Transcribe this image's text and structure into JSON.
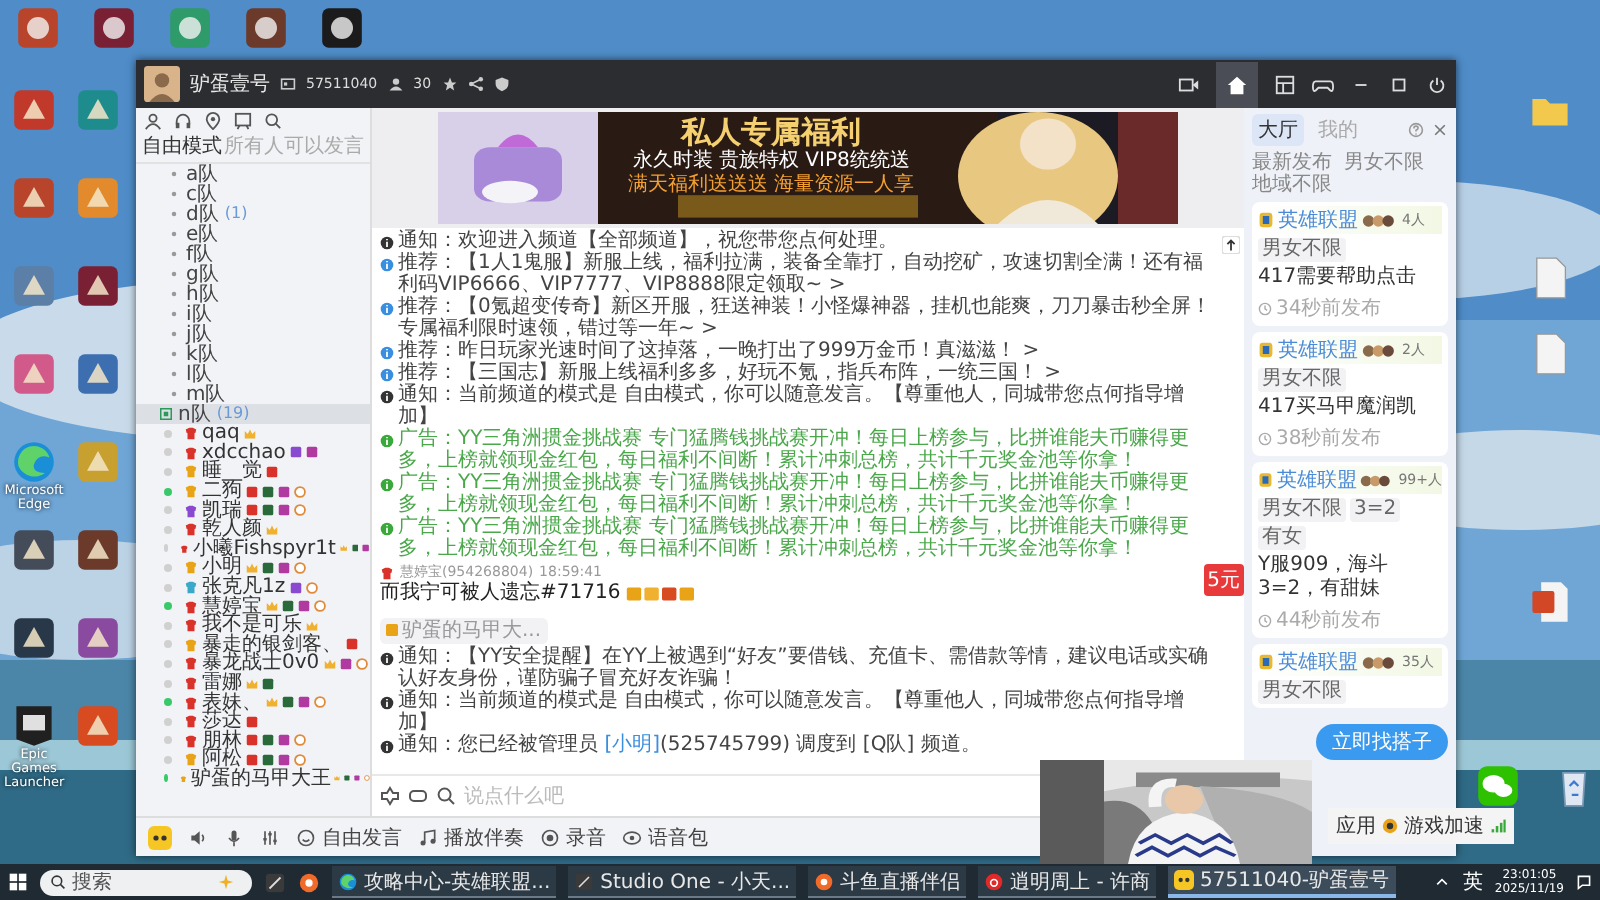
{
  "desktop": {
    "top_icons": [
      {
        "kind": "app"
      },
      {
        "kind": "app"
      },
      {
        "kind": "app"
      },
      {
        "kind": "app"
      },
      {
        "kind": "app"
      }
    ],
    "left_icons": [
      {
        "kind": "app"
      },
      {
        "kind": "app"
      },
      {
        "kind": "app"
      },
      {
        "kind": "app"
      },
      {
        "kind": "app"
      },
      {
        "kind": "app"
      },
      {
        "kind": "app"
      },
      {
        "kind": "app"
      },
      {
        "kind": "edge",
        "label": "Microsoft Edge"
      },
      {
        "kind": "app"
      },
      {
        "kind": "app"
      },
      {
        "kind": "app"
      },
      {
        "kind": "app"
      },
      {
        "kind": "app"
      },
      {
        "kind": "epic",
        "label": "Epic Games Launcher"
      },
      {
        "kind": "app"
      }
    ],
    "right_icons": [
      {
        "kind": "folder"
      },
      {
        "kind": "file"
      },
      {
        "kind": "file"
      },
      {
        "kind": "ppt"
      }
    ],
    "bottom_icons": [
      {
        "kind": "wechat"
      },
      {
        "kind": "recycle"
      }
    ]
  },
  "window": {
    "title": "驴蛋壹号",
    "channel_id": "57511040",
    "online": "30"
  },
  "left_panel": {
    "mode": "自由模式",
    "mode_hint": "所有人可以发言",
    "channels": [
      {
        "name": "a队",
        "expanded": false
      },
      {
        "name": "c队",
        "expanded": false
      },
      {
        "name": "d队",
        "count": "(1)",
        "expanded": false
      },
      {
        "name": "e队",
        "expanded": false
      },
      {
        "name": "f队",
        "expanded": false
      },
      {
        "name": "g队",
        "expanded": false
      },
      {
        "name": "h队",
        "expanded": false
      },
      {
        "name": "i队",
        "expanded": false
      },
      {
        "name": "j队",
        "expanded": false
      },
      {
        "name": "k队",
        "expanded": false
      },
      {
        "name": "l队",
        "expanded": false
      },
      {
        "name": "m队",
        "expanded": false
      },
      {
        "name": "n队",
        "count": "(19)",
        "expanded": true,
        "children": [
          {
            "name": "qaq",
            "online": false,
            "kind": "red",
            "badges": [
              {
                "kind": "crown"
              }
            ]
          },
          {
            "name": "xdcchao",
            "online": false,
            "kind": "red",
            "badges": [
              {
                "kind": "purple"
              },
              {
                "kind": "vip"
              }
            ]
          },
          {
            "name": "睡__觉",
            "online": false,
            "kind": "gold",
            "badges": [
              {
                "kind": "red"
              }
            ]
          },
          {
            "name": "二狗",
            "online": true,
            "kind": "gold",
            "badges": [
              {
                "kind": "red"
              },
              {
                "kind": "level"
              },
              {
                "kind": "vip"
              },
              {
                "kind": "medal"
              }
            ]
          },
          {
            "name": "凯瑞",
            "online": false,
            "kind": "purple",
            "badges": [
              {
                "kind": "red"
              },
              {
                "kind": "level"
              },
              {
                "kind": "vip"
              },
              {
                "kind": "medal"
              }
            ]
          },
          {
            "name": "乾人颜",
            "online": false,
            "kind": "red",
            "badges": [
              {
                "kind": "crown"
              }
            ]
          },
          {
            "name": "小曦Fishspyr1t",
            "online": false,
            "kind": "red",
            "badges": [
              {
                "kind": "crown"
              },
              {
                "kind": "level"
              },
              {
                "kind": "vip"
              }
            ]
          },
          {
            "name": "小明",
            "online": false,
            "kind": "gold",
            "badges": [
              {
                "kind": "crown"
              },
              {
                "kind": "level"
              },
              {
                "kind": "vip"
              },
              {
                "kind": "medal"
              }
            ]
          },
          {
            "name": "张克凡1z",
            "online": false,
            "kind": "blue",
            "badges": [
              {
                "kind": "purple"
              },
              {
                "kind": "medal"
              }
            ]
          },
          {
            "name": "慧婷宝",
            "online": true,
            "kind": "red",
            "badges": [
              {
                "kind": "crown"
              },
              {
                "kind": "level"
              },
              {
                "kind": "vip"
              },
              {
                "kind": "medal"
              }
            ]
          },
          {
            "name": "我不是可乐",
            "online": false,
            "kind": "red",
            "badges": [
              {
                "kind": "crown"
              }
            ]
          },
          {
            "name": "暴走的银剑客、",
            "online": false,
            "kind": "gold",
            "badges": [
              {
                "kind": "red"
              }
            ]
          },
          {
            "name": "暴龙战士0v0",
            "online": false,
            "kind": "red",
            "badges": [
              {
                "kind": "crown"
              },
              {
                "kind": "vip"
              },
              {
                "kind": "medal"
              }
            ]
          },
          {
            "name": "雷娜",
            "online": false,
            "kind": "red",
            "badges": [
              {
                "kind": "crown"
              },
              {
                "kind": "level"
              }
            ]
          },
          {
            "name": "表妹、",
            "online": true,
            "kind": "red",
            "badges": [
              {
                "kind": "crown"
              },
              {
                "kind": "level"
              },
              {
                "kind": "vip"
              },
              {
                "kind": "medal"
              }
            ]
          },
          {
            "name": "莎达",
            "online": false,
            "kind": "red",
            "badges": [
              {
                "kind": "red"
              }
            ]
          },
          {
            "name": "朋林",
            "online": false,
            "kind": "red",
            "badges": [
              {
                "kind": "red"
              },
              {
                "kind": "level"
              },
              {
                "kind": "vip"
              },
              {
                "kind": "medal"
              }
            ]
          },
          {
            "name": "阿松",
            "online": false,
            "kind": "gold",
            "badges": [
              {
                "kind": "red"
              },
              {
                "kind": "level"
              },
              {
                "kind": "vip"
              },
              {
                "kind": "medal"
              }
            ]
          },
          {
            "name": "驴蛋的马甲大王",
            "online": true,
            "kind": "gold",
            "badges": [
              {
                "kind": "crown"
              },
              {
                "kind": "level"
              },
              {
                "kind": "vip"
              },
              {
                "kind": "medal"
              }
            ]
          }
        ]
      }
    ]
  },
  "banner": {
    "title": "私人专属福利",
    "subtitle": "永久时装 贵族特权 VIP8统统送",
    "slogan": "满天福利送送送 海量资源一人享"
  },
  "messages": [
    {
      "kind": "notice",
      "label": "通知：",
      "text": "欢迎进入频道【全部频道】，祝您带您点何处理。"
    },
    {
      "kind": "recommend",
      "label": "推荐：",
      "text": "【1人1鬼服】新服上线，福利拉满，装备全靠打，自动挖矿，攻速切割全满！还有福利码VIP6666、VIP7777、VIP8888限定领取~ >"
    },
    {
      "kind": "recommend",
      "label": "推荐：",
      "text": "【0氪超变传奇】新区开服，狂送神装！小怪爆神器，挂机也能爽，刀刀暴击秒全屏！专属福利限时速领，错过等一年~ >"
    },
    {
      "kind": "recommend",
      "label": "推荐：",
      "text": "昨日玩家光速时间了这掉落，一晚打出了999万金币！真滋滋！ >"
    },
    {
      "kind": "recommend",
      "label": "推荐：",
      "text": "【三国志】新服上线福利多多，好玩不氪，指兵布阵，一统三国！ >"
    },
    {
      "kind": "notice",
      "label": "通知：",
      "text": "当前频道的模式是 自由模式，你可以随意发言。【尊重他人，同城带您点何指导增加】"
    },
    {
      "kind": "ad",
      "label": "广告：",
      "text": "YY三角洲掼金挑战赛 专门猛腾钱挑战赛开冲！每日上榜参与，比拼谁能夫币赚得更多，上榜就领现金红包，每日福利不间断！累计冲刺总榜，共计千元奖金池等你拿！"
    },
    {
      "kind": "ad",
      "label": "广告：",
      "text": "YY三角洲掼金挑战赛 专门猛腾钱挑战赛开冲！每日上榜参与，比拼谁能夫币赚得更多，上榜就领现金红包，每日福利不间断！累计冲刺总榜，共计千元奖金池等你拿！"
    },
    {
      "kind": "ad",
      "label": "广告：",
      "text": "YY三角洲掼金挑战赛 专门猛腾钱挑战赛开冲！每日上榜参与，比拼谁能夫币赚得更多，上榜就领现金红包，每日福利不间断！累计冲刺总榜，共计千元奖金池等你拿！"
    },
    {
      "kind": "chat",
      "user": "慧婷宝(954268804)",
      "time": "18:59:41",
      "text": "而我宁可被人遗忘#71716",
      "reply": "驴蛋的马甲大..."
    },
    {
      "kind": "notice",
      "label": "通知：",
      "text": "【YY安全提醒】在YY上被遇到“好友”要借钱、充值卡、需借款等情，建议电话或实确认好友身份，谨防骗子冒充好友诈骗！"
    },
    {
      "kind": "notice",
      "label": "通知：",
      "text": "当前频道的模式是 自由模式，你可以随意发言。【尊重他人，同城带您点何指导增加】"
    },
    {
      "kind": "notice",
      "label": "通知：",
      "text": "您已经被管理员 ",
      "link": "[小明]",
      "after": "(525745799) 调度到 [Q队] 频道。"
    }
  ],
  "promo": "5元",
  "input": {
    "placeholder": "说点什么吧"
  },
  "bottom_toolbar": [
    {
      "kind": "speak",
      "label": "自由发言"
    },
    {
      "kind": "music",
      "label": "播放伴奏"
    },
    {
      "kind": "record",
      "label": "录音"
    },
    {
      "kind": "voicepack",
      "label": "语音包"
    }
  ],
  "right_panel": {
    "tabs": [
      {
        "label": "大厅",
        "selected": true
      },
      {
        "label": "我的",
        "selected": false
      }
    ],
    "filters": [
      "最新发布",
      "男女不限",
      "地域不限"
    ],
    "cards": [
      {
        "game": "英雄联盟",
        "count": "4人",
        "tags": [
          "男女不限"
        ],
        "text": "417需要帮助点击",
        "time": "34秒前发布"
      },
      {
        "game": "英雄联盟",
        "count": "2人",
        "tags": [
          "男女不限"
        ],
        "text": "417买马甲魔润凯",
        "time": "38秒前发布"
      },
      {
        "game": "英雄联盟",
        "count": "99+人",
        "tags": [
          "男女不限",
          "3=2",
          "有女"
        ],
        "text": "Y服909，海斗3=2，有甜妹",
        "time": "44秒前发布"
      },
      {
        "game": "英雄联盟",
        "count": "35人",
        "tags": [
          "男女不限"
        ]
      }
    ],
    "action": "立即找搭子"
  },
  "tray_popup": {
    "app": "应用",
    "boost": "游戏加速"
  },
  "taskbar": {
    "search_placeholder": "搜索",
    "items": [
      {
        "kind": "edge",
        "label": "攻略中心-英雄联盟...",
        "active": false
      },
      {
        "kind": "studio",
        "label": "Studio One - 小天...",
        "active": false
      },
      {
        "kind": "douyu",
        "label": "斗鱼直播伴侣",
        "active": false
      },
      {
        "kind": "music",
        "label": "逍明周上 - 许商",
        "active": false
      },
      {
        "kind": "yy",
        "label": "57511040-驴蛋壹号",
        "active": true
      }
    ],
    "ime": "英",
    "time": "23:01:05",
    "date": "2025/11/19"
  }
}
